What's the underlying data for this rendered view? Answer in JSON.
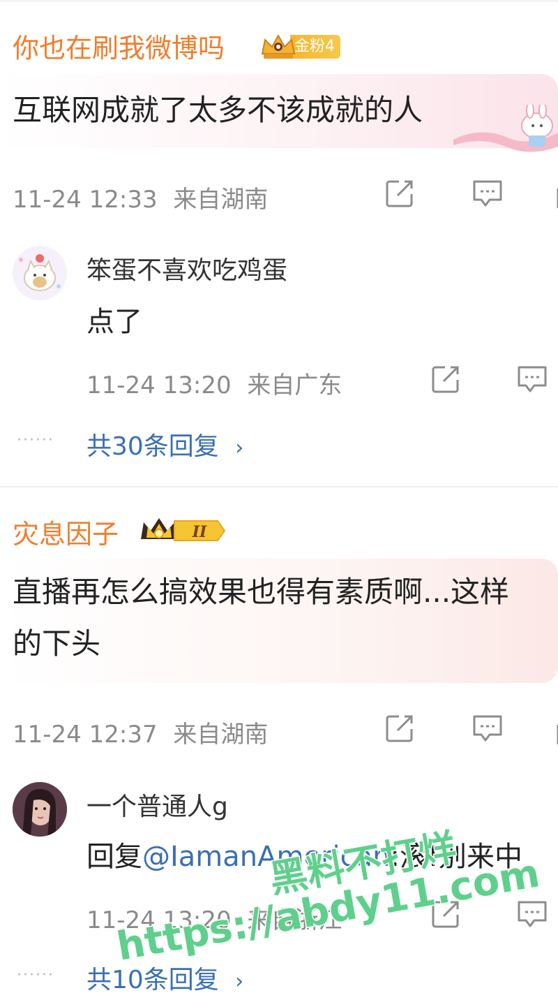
{
  "comments": [
    {
      "username": "你也在刷我微博吗",
      "badge_label": "金粉4",
      "badge_icon": "crown-fan-badge",
      "text": "互联网成就了太多不该成就的人",
      "time": "11-24 12:33",
      "location": "来自湖南",
      "reply": {
        "username": "笨蛋不喜欢吃鸡蛋",
        "text": "点了",
        "time": "11-24 13:20",
        "location": "来自广东"
      },
      "more_replies": "共30条回复"
    },
    {
      "username": "灾息因子",
      "badge_label": "II",
      "badge_icon": "crown-level-badge",
      "text_line1": "直播再怎么搞效果也得有素质啊...这样",
      "text_line2": "的下头",
      "time": "11-24 12:37",
      "location": "来自湖南",
      "reply": {
        "username": "一个普通人g",
        "reply_prefix": "回复",
        "mention": "@IamanAmerican",
        "reply_rest": ":滚!别来中",
        "time": "11-24 13:20",
        "location": "来自浙江"
      },
      "more_replies": "共10条回复"
    }
  ],
  "watermark": {
    "line1": "黑料不打烊",
    "line2": "https://abdy11.com"
  },
  "colors": {
    "username": "#f07d2a",
    "link": "#3a6fb4",
    "meta": "#8a8a8a",
    "watermark": "#5fd08c"
  }
}
